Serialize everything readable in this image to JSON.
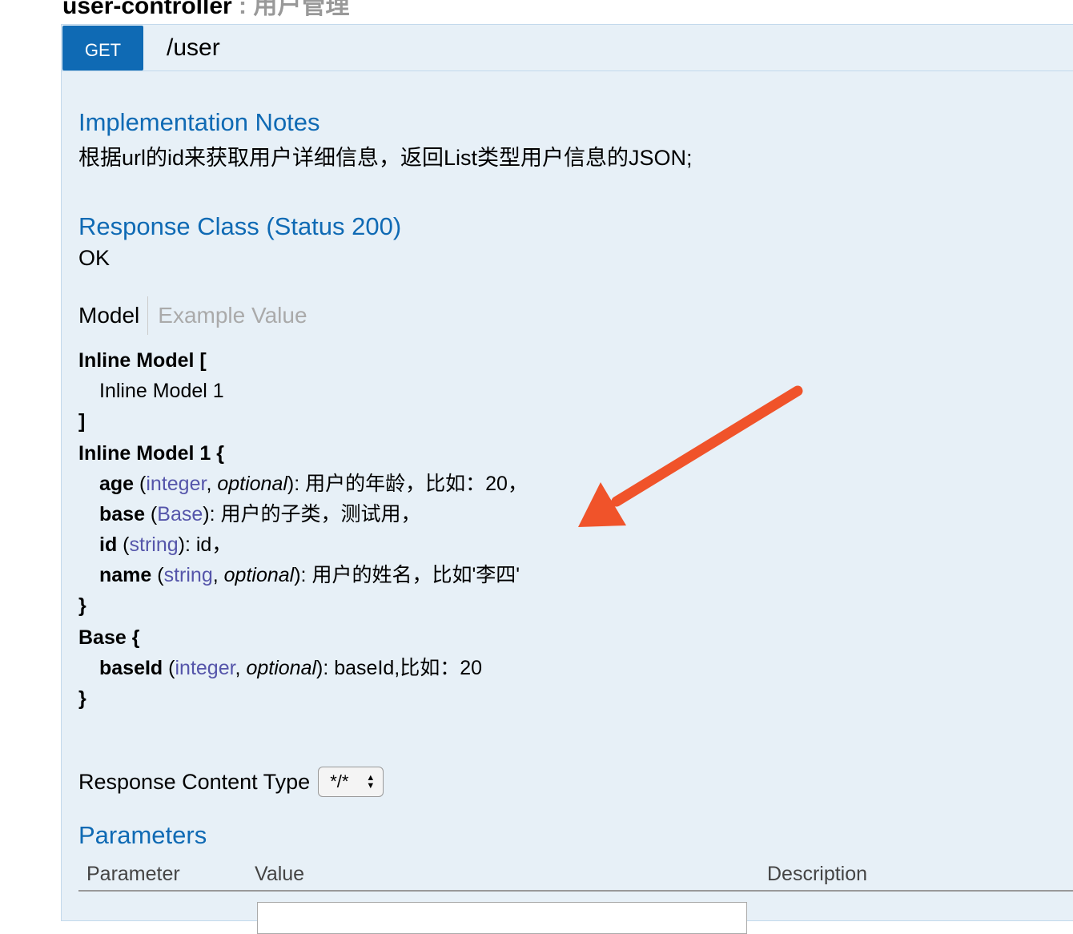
{
  "header": {
    "controller_title": "user-controller",
    "controller_desc": " : 用户管理"
  },
  "operation": {
    "method": "GET",
    "path": "/user"
  },
  "implementation_notes": {
    "heading": "Implementation Notes",
    "text": "根据url的id来获取用户详细信息，返回List类型用户信息的JSON;"
  },
  "response_class": {
    "heading": "Response Class (Status 200)",
    "status_text": "OK"
  },
  "tabs": {
    "model": "Model",
    "example": "Example Value"
  },
  "model": {
    "inline_open": "Inline Model [",
    "inline_item": "Inline Model 1",
    "inline_close": "]",
    "model1_open": "Inline Model 1 {",
    "age_name": "age",
    "age_type": "integer",
    "age_opt": "optional",
    "age_desc": ": 用户的年龄，比如：20，",
    "base_name": "base",
    "base_type": "Base",
    "base_desc": ": 用户的子类，测试用，",
    "id_name": "id",
    "id_type": "string",
    "id_desc": ": id，",
    "name_name": "name",
    "name_type": "string",
    "name_opt": "optional",
    "name_desc": ": 用户的姓名，比如'李四'",
    "model1_close": "}",
    "base_open": "Base {",
    "baseid_name": "baseId",
    "baseid_type": "integer",
    "baseid_opt": "optional",
    "baseid_desc": ": baseId,比如：20",
    "base_close": "}"
  },
  "response_content_type": {
    "label": "Response Content Type",
    "selected": "*/*"
  },
  "parameters": {
    "heading": "Parameters",
    "columns": [
      "Parameter",
      "Value",
      "Description"
    ]
  },
  "colors": {
    "accent": "#0f6ab4",
    "panel_bg": "#e7f0f7",
    "annotation_arrow": "#f0532a"
  },
  "icons": {
    "select_arrows": "sort-arrows-icon",
    "annotation": "arrow-annotation-icon"
  }
}
